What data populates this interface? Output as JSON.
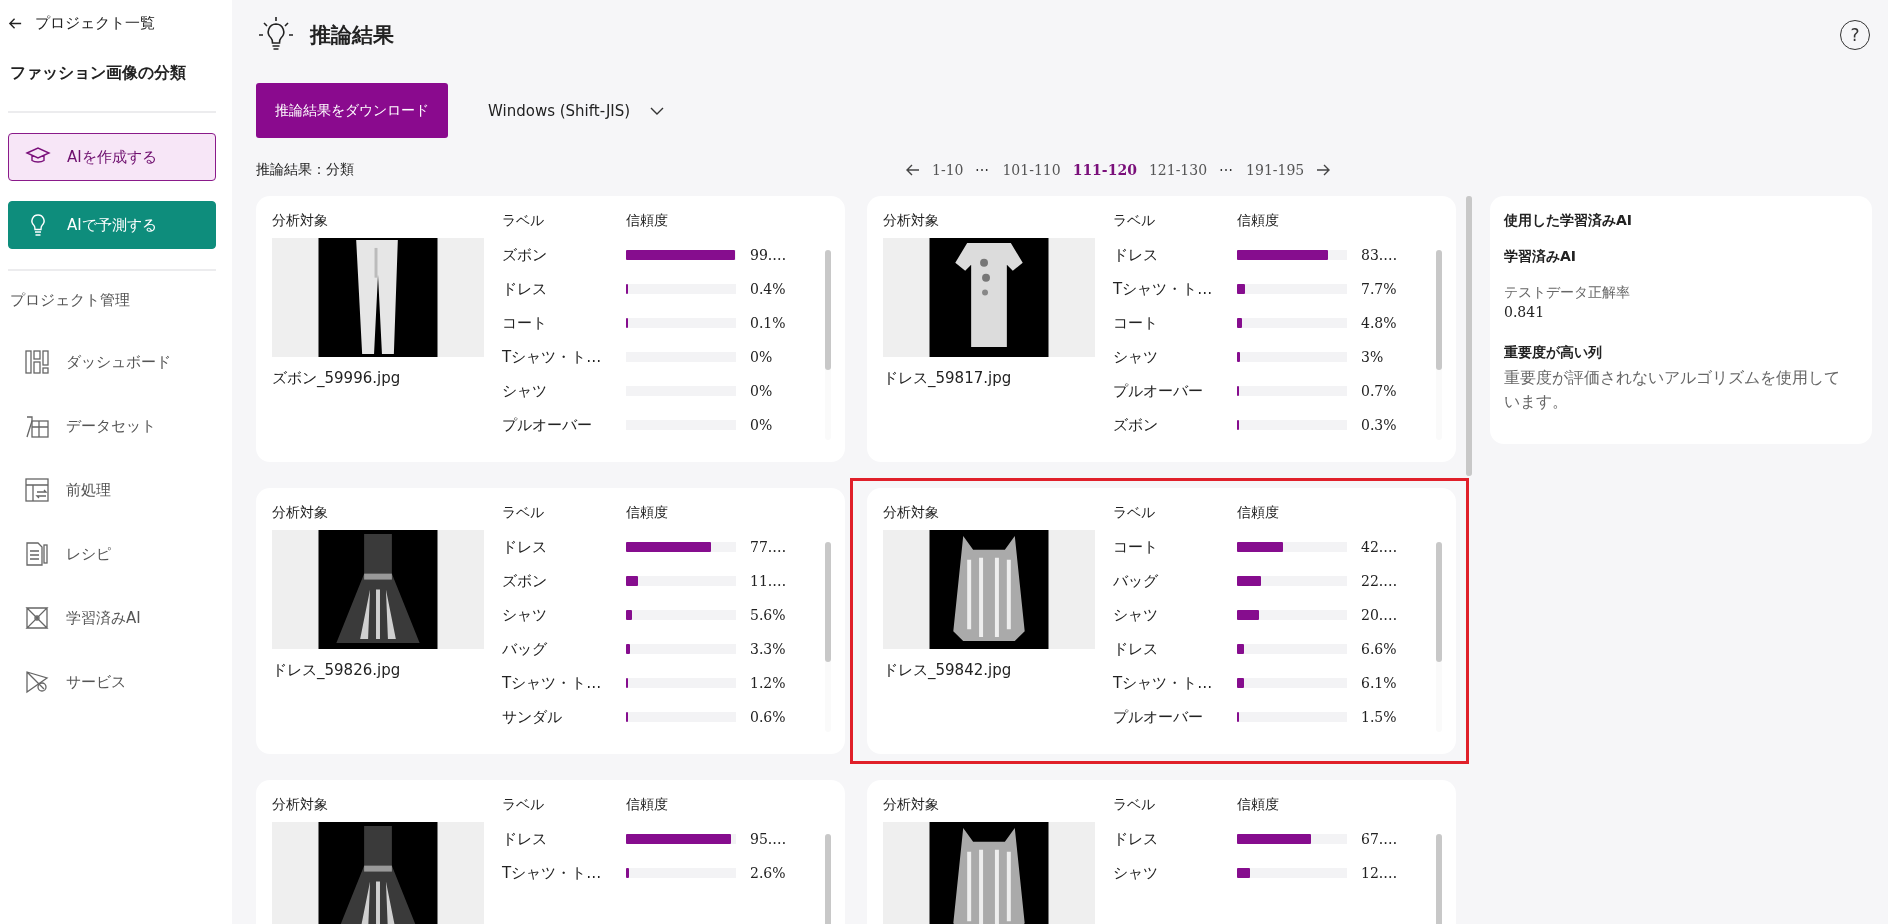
{
  "sidebar": {
    "back_link": "プロジェクト一覧",
    "project_title": "ファッション画像の分類",
    "actions": [
      {
        "label": "AIを作成する",
        "selected": false
      },
      {
        "label": "AIで予測する",
        "selected": true
      }
    ],
    "section_title": "プロジェクト管理",
    "items": [
      {
        "label": "ダッシュボード"
      },
      {
        "label": "データセット"
      },
      {
        "label": "前処理"
      },
      {
        "label": "レシピ"
      },
      {
        "label": "学習済みAI"
      },
      {
        "label": "サービス"
      }
    ]
  },
  "header": {
    "title": "推論結果",
    "help": "?"
  },
  "toolbar": {
    "download_button": "推論結果をダウンロード",
    "encoding": "Windows (Shift-JIS)"
  },
  "results_caption": "推論結果：分類",
  "pagination": [
    {
      "label": "1-10",
      "kind": "page",
      "selected": false
    },
    {
      "label": "⋯",
      "kind": "gap",
      "selected": false
    },
    {
      "label": "101-110",
      "kind": "page",
      "selected": false
    },
    {
      "label": "111-120",
      "kind": "page",
      "selected": true
    },
    {
      "label": "121-130",
      "kind": "page",
      "selected": false
    },
    {
      "label": "⋯",
      "kind": "gap",
      "selected": false
    },
    {
      "label": "191-195",
      "kind": "page",
      "selected": false
    }
  ],
  "cards": [
    {
      "target_label": "分析対象",
      "label_header": "ラベル",
      "confidence_header": "信頼度",
      "filename": "ズボン_59996.jpg",
      "highlighted": false,
      "rows": [
        {
          "label": "ズボン",
          "level": 0.99,
          "reading": "99.…"
        },
        {
          "label": "ドレス",
          "level": 0.004,
          "reading": "0.4%"
        },
        {
          "label": "コート",
          "level": 0.001,
          "reading": "0.1%"
        },
        {
          "label": "Tシャツ・ト…",
          "level": 0,
          "reading": "0%"
        },
        {
          "label": "シャツ",
          "level": 0,
          "reading": "0%"
        },
        {
          "label": "プルオーバー",
          "level": 0,
          "reading": "0%"
        }
      ]
    },
    {
      "target_label": "分析対象",
      "label_header": "ラベル",
      "confidence_header": "信頼度",
      "filename": "ドレス_59817.jpg",
      "highlighted": false,
      "rows": [
        {
          "label": "ドレス",
          "level": 0.83,
          "reading": "83.…"
        },
        {
          "label": "Tシャツ・ト…",
          "level": 0.077,
          "reading": "7.7%"
        },
        {
          "label": "コート",
          "level": 0.048,
          "reading": "4.8%"
        },
        {
          "label": "シャツ",
          "level": 0.03,
          "reading": "3%"
        },
        {
          "label": "プルオーバー",
          "level": 0.007,
          "reading": "0.7%"
        },
        {
          "label": "ズボン",
          "level": 0.003,
          "reading": "0.3%"
        }
      ]
    },
    {
      "target_label": "分析対象",
      "label_header": "ラベル",
      "confidence_header": "信頼度",
      "filename": "ドレス_59826.jpg",
      "highlighted": false,
      "rows": [
        {
          "label": "ドレス",
          "level": 0.77,
          "reading": "77.…"
        },
        {
          "label": "ズボン",
          "level": 0.11,
          "reading": "11.…"
        },
        {
          "label": "シャツ",
          "level": 0.056,
          "reading": "5.6%"
        },
        {
          "label": "バッグ",
          "level": 0.033,
          "reading": "3.3%"
        },
        {
          "label": "Tシャツ・ト…",
          "level": 0.012,
          "reading": "1.2%"
        },
        {
          "label": "サンダル",
          "level": 0.006,
          "reading": "0.6%"
        }
      ]
    },
    {
      "target_label": "分析対象",
      "label_header": "ラベル",
      "confidence_header": "信頼度",
      "filename": "ドレス_59842.jpg",
      "highlighted": true,
      "rows": [
        {
          "label": "コート",
          "level": 0.42,
          "reading": "42.…"
        },
        {
          "label": "バッグ",
          "level": 0.22,
          "reading": "22.…"
        },
        {
          "label": "シャツ",
          "level": 0.2,
          "reading": "20.…"
        },
        {
          "label": "ドレス",
          "level": 0.066,
          "reading": "6.6%"
        },
        {
          "label": "Tシャツ・ト…",
          "level": 0.061,
          "reading": "6.1%"
        },
        {
          "label": "プルオーバー",
          "level": 0.015,
          "reading": "1.5%"
        }
      ]
    },
    {
      "target_label": "分析対象",
      "label_header": "ラベル",
      "confidence_header": "信頼度",
      "highlighted": false,
      "rows": [
        {
          "label": "ドレス",
          "level": 0.95,
          "reading": "95.…"
        },
        {
          "label": "Tシャツ・ト…",
          "level": 0.026,
          "reading": "2.6%"
        }
      ]
    },
    {
      "target_label": "分析対象",
      "label_header": "ラベル",
      "confidence_header": "信頼度",
      "highlighted": false,
      "rows": [
        {
          "label": "ドレス",
          "level": 0.67,
          "reading": "67.…"
        },
        {
          "label": "シャツ",
          "level": 0.12,
          "reading": "12.…"
        }
      ]
    }
  ],
  "model_panel": {
    "title": "使用した学習済みAI",
    "model_name": "学習済みAI",
    "metric_label": "テストデータ正解率",
    "metric_value": "0.841",
    "importance_title": "重要度が高い列",
    "importance_text": "重要度が評価されないアルゴリズムを使用しています。"
  }
}
